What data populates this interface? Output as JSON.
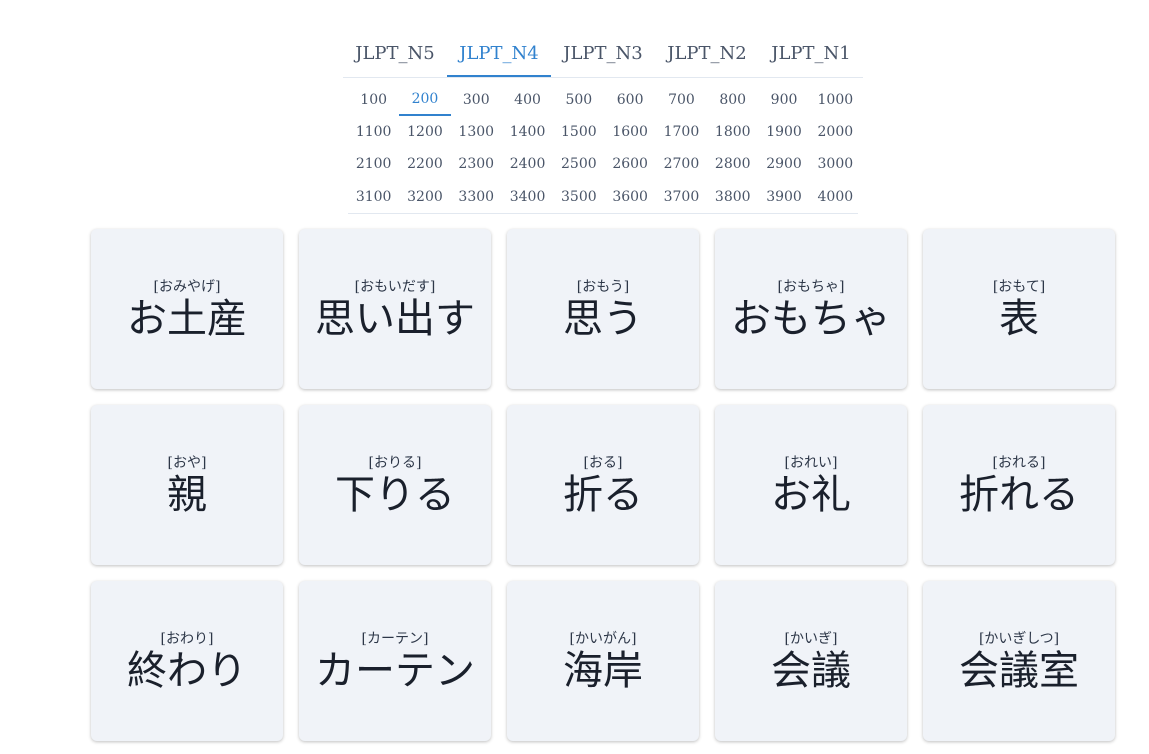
{
  "level_tabs": [
    {
      "label": "JLPT_N5",
      "active": false
    },
    {
      "label": "JLPT_N4",
      "active": true
    },
    {
      "label": "JLPT_N3",
      "active": false
    },
    {
      "label": "JLPT_N2",
      "active": false
    },
    {
      "label": "JLPT_N1",
      "active": false
    }
  ],
  "ranges": [
    {
      "label": "100"
    },
    {
      "label": "200",
      "active": true
    },
    {
      "label": "300"
    },
    {
      "label": "400"
    },
    {
      "label": "500"
    },
    {
      "label": "600"
    },
    {
      "label": "700"
    },
    {
      "label": "800"
    },
    {
      "label": "900"
    },
    {
      "label": "1000"
    },
    {
      "label": "1100"
    },
    {
      "label": "1200"
    },
    {
      "label": "1300"
    },
    {
      "label": "1400"
    },
    {
      "label": "1500"
    },
    {
      "label": "1600"
    },
    {
      "label": "1700"
    },
    {
      "label": "1800"
    },
    {
      "label": "1900"
    },
    {
      "label": "2000"
    },
    {
      "label": "2100"
    },
    {
      "label": "2200"
    },
    {
      "label": "2300"
    },
    {
      "label": "2400"
    },
    {
      "label": "2500"
    },
    {
      "label": "2600"
    },
    {
      "label": "2700"
    },
    {
      "label": "2800"
    },
    {
      "label": "2900"
    },
    {
      "label": "3000"
    },
    {
      "label": "3100"
    },
    {
      "label": "3200"
    },
    {
      "label": "3300"
    },
    {
      "label": "3400"
    },
    {
      "label": "3500"
    },
    {
      "label": "3600"
    },
    {
      "label": "3700"
    },
    {
      "label": "3800"
    },
    {
      "label": "3900"
    },
    {
      "label": "4000"
    }
  ],
  "cards": [
    {
      "reading": "[おみやげ]",
      "word": "お土産"
    },
    {
      "reading": "[おもいだす]",
      "word": "思い出す"
    },
    {
      "reading": "[おもう]",
      "word": "思う"
    },
    {
      "reading": "[おもちゃ]",
      "word": "おもちゃ"
    },
    {
      "reading": "[おもて]",
      "word": "表"
    },
    {
      "reading": "[おや]",
      "word": "親"
    },
    {
      "reading": "[おりる]",
      "word": "下りる"
    },
    {
      "reading": "[おる]",
      "word": "折る"
    },
    {
      "reading": "[おれい]",
      "word": "お礼"
    },
    {
      "reading": "[おれる]",
      "word": "折れる"
    },
    {
      "reading": "[おわり]",
      "word": "終わり"
    },
    {
      "reading": "[カーテン]",
      "word": "カーテン"
    },
    {
      "reading": "[かいがん]",
      "word": "海岸"
    },
    {
      "reading": "[かいぎ]",
      "word": "会議"
    },
    {
      "reading": "[かいぎしつ]",
      "word": "会議室"
    }
  ]
}
